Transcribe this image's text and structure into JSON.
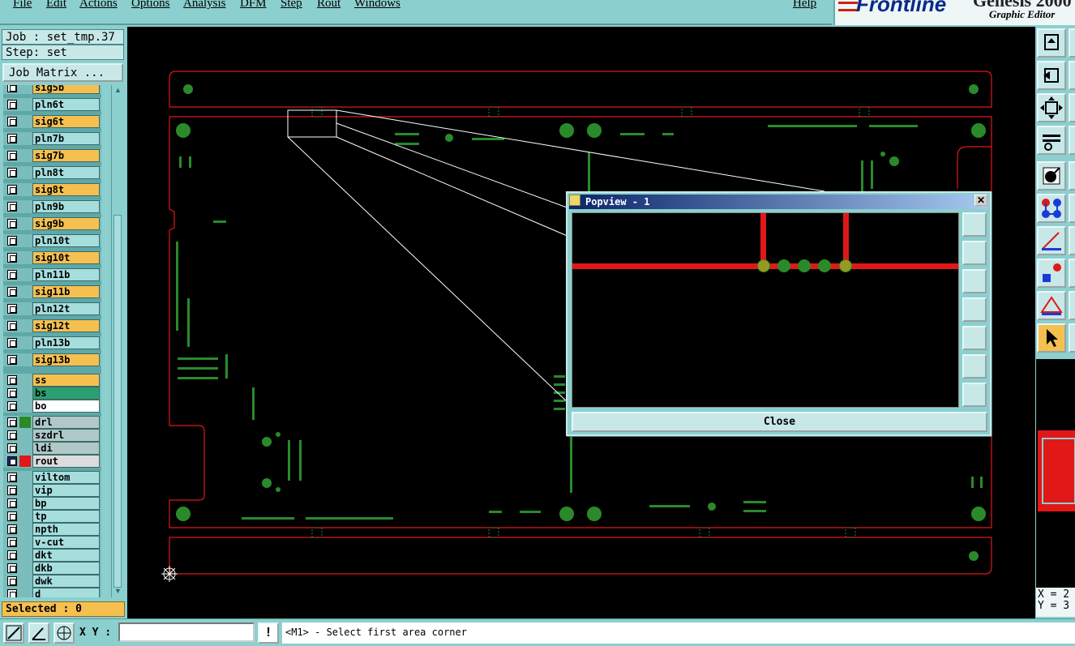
{
  "menu": [
    "File",
    "Edit",
    "Actions",
    "Options",
    "Analysis",
    "DFM",
    "Step",
    "Rout",
    "Windows",
    "Help"
  ],
  "brand": {
    "logo": "Frontline",
    "product": "Genesis 2000",
    "subtitle": "Graphic Editor"
  },
  "job": {
    "job_label": "Job : set_tmp.37",
    "step_label": "Step: set",
    "matrix_button": "Job Matrix ..."
  },
  "layers": [
    {
      "name": "sig5b",
      "color": "#f6c050"
    },
    {
      "name": "pln6t",
      "color": "#a6dede"
    },
    {
      "name": "sig6t",
      "color": "#f6c050"
    },
    {
      "name": "pln7b",
      "color": "#a6dede"
    },
    {
      "name": "sig7b",
      "color": "#f6c050"
    },
    {
      "name": "pln8t",
      "color": "#a6dede"
    },
    {
      "name": "sig8t",
      "color": "#f6c050"
    },
    {
      "name": "pln9b",
      "color": "#a6dede"
    },
    {
      "name": "sig9b",
      "color": "#f6c050"
    },
    {
      "name": "pln10t",
      "color": "#a6dede"
    },
    {
      "name": "sig10t",
      "color": "#f6c050"
    },
    {
      "name": "pln11b",
      "color": "#a6dede"
    },
    {
      "name": "sig11b",
      "color": "#f6c050"
    },
    {
      "name": "pln12t",
      "color": "#a6dede"
    },
    {
      "name": "sig12t",
      "color": "#f6c050"
    },
    {
      "name": "pln13b",
      "color": "#a6dede"
    },
    {
      "name": "sig13b",
      "color": "#f6c050"
    },
    {
      "name": "ss",
      "color": "#f6c050"
    },
    {
      "name": "bs",
      "color": "#2aa070"
    },
    {
      "name": "bo",
      "color": "#ffffff"
    },
    {
      "name": "drl",
      "color": "#b0c8c8",
      "swatch": "#2a8a2a"
    },
    {
      "name": "szdrl",
      "color": "#b0c8c8"
    },
    {
      "name": "ldi",
      "color": "#b0c8c8"
    },
    {
      "name": "rout",
      "color": "#dcdcdc",
      "swatch": "#e01818",
      "selected": true
    },
    {
      "name": "viltom",
      "color": "#a6dede"
    },
    {
      "name": "vip",
      "color": "#a6dede"
    },
    {
      "name": "bp",
      "color": "#a6dede"
    },
    {
      "name": "tp",
      "color": "#a6dede"
    },
    {
      "name": "npth",
      "color": "#a6dede"
    },
    {
      "name": "v-cut",
      "color": "#a6dede"
    },
    {
      "name": "dkt",
      "color": "#a6dede"
    },
    {
      "name": "dkb",
      "color": "#a6dede"
    },
    {
      "name": "dwk",
      "color": "#a6dede"
    },
    {
      "name": "d",
      "color": "#a6dede"
    }
  ],
  "selected_label": "Selected : 0",
  "popview": {
    "title": "Popview - 1",
    "close_label": "Close"
  },
  "coords": {
    "x": "X = 2",
    "y": "Y = 3"
  },
  "status": {
    "xy_label": "X Y :",
    "xy_value": "",
    "info_button": "!",
    "prompt": "<M1> - Select first area corner"
  },
  "colors": {
    "panel": "#8ccfcf",
    "signal": "#f6c050",
    "rout": "#e01818",
    "pad": "#2a8a2a"
  }
}
